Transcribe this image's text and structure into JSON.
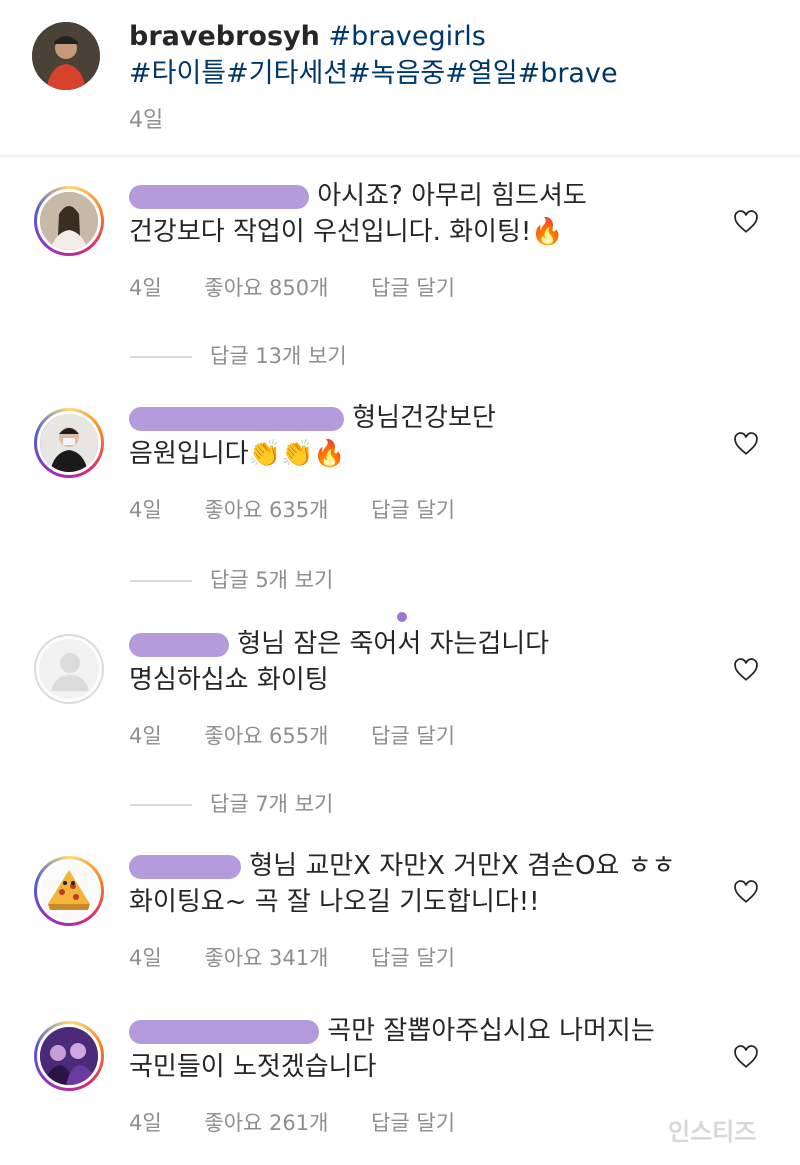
{
  "post": {
    "username": "bravebrosyh",
    "hashtags_line1": "#bravegirls",
    "hashtags_line2": "#타이틀#기타세션#녹음중#열일#brave",
    "time": "4일"
  },
  "comments": [
    {
      "text_line1": "아시죠? 아무리 힘드셔도",
      "text_line2": "건강보다 작업이 우선입니다. 화이팅!🔥",
      "time": "4일",
      "likes": "좋아요 850개",
      "reply": "답글 달기",
      "view_replies": "답글 13개 보기"
    },
    {
      "text_line1": "형님건강보단",
      "text_line2": "음원입니다👏👏🔥",
      "time": "4일",
      "likes": "좋아요 635개",
      "reply": "답글 달기",
      "view_replies": "답글 5개 보기"
    },
    {
      "text_line1": "형님 잠은 죽어서 자는겁니다",
      "text_line2": "명심하십쇼 화이팅",
      "time": "4일",
      "likes": "좋아요 655개",
      "reply": "답글 달기",
      "view_replies": "답글 7개 보기"
    },
    {
      "text_line1": "형님 교만X 자만X 거만X 겸손O요 ㅎㅎ",
      "text_line2": "화이팅요~ 곡 잘 나오길 기도합니다!!",
      "time": "4일",
      "likes": "좋아요 341개",
      "reply": "답글 달기"
    },
    {
      "text_line1": "곡만 잘뽑아주십시요 나머지는",
      "text_line2": "국민들이 노젓겠습니다",
      "time": "4일",
      "likes": "좋아요 261개",
      "reply": "답글 달기"
    }
  ],
  "watermark": "인스티즈",
  "colors": {
    "tag": "#00376b",
    "meta": "#8e8e8e",
    "redaction": "#a68ad6"
  }
}
